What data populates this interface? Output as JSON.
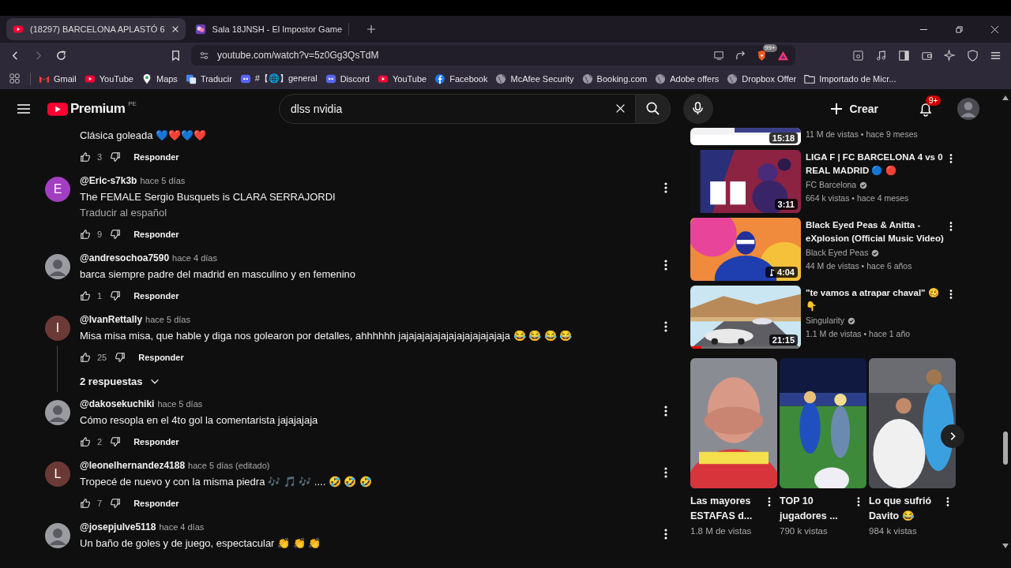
{
  "tabs": [
    {
      "title": "(18297) BARCELONA APLASTÓ 6",
      "selected": true
    },
    {
      "title": "Sala 18JNSH - El Impostor Game",
      "selected": false
    }
  ],
  "address_bar": {
    "url": "youtube.com/watch?v=5z0Gg3QsTdM",
    "shield_badge": "99+"
  },
  "bookmarks": [
    {
      "label": "Gmail",
      "kind": "gmail"
    },
    {
      "label": "YouTube",
      "kind": "youtube"
    },
    {
      "label": "Maps",
      "kind": "maps"
    },
    {
      "label": "Traducir",
      "kind": "translate"
    },
    {
      "label": "#【🌐】general",
      "kind": "discord"
    },
    {
      "label": "Discord",
      "kind": "discord"
    },
    {
      "label": "YouTube",
      "kind": "youtube"
    },
    {
      "label": "Facebook",
      "kind": "facebook"
    },
    {
      "label": "McAfee Security",
      "kind": "globe"
    },
    {
      "label": "Booking.com",
      "kind": "globe"
    },
    {
      "label": "Adobe offers",
      "kind": "globe"
    },
    {
      "label": "Dropbox Offer",
      "kind": "globe"
    },
    {
      "label": "Importado de Micr...",
      "kind": "folder"
    }
  ],
  "youtube_header": {
    "logo": "Premium",
    "region": "PE",
    "search": {
      "value": "dlss nvidia"
    },
    "create_label": "Crear",
    "notification_badge": "9+"
  },
  "comments": [
    {
      "text": "Clásica goleada 💙❤️💙❤️",
      "likes": "3",
      "reply_label": "Responder"
    },
    {
      "user": "@Eric-s7k3b",
      "time": "hace 5 días",
      "text": "The FEMALE Sergio Busquets is CLARA SERRAJORDI",
      "translate": "Traducir al español",
      "likes": "9",
      "reply_label": "Responder",
      "avatar": {
        "kind": "letter",
        "letter": "E",
        "color": "#a23ec2"
      }
    },
    {
      "user": "@andresochoa7590",
      "time": "hace 4 días",
      "text": "barca siempre padre del madrid en masculino y en femenino",
      "likes": "1",
      "reply_label": "Responder"
    },
    {
      "user": "@IvanRettally",
      "time": "hace 5 días",
      "text": "Misa misa misa, que hable y diga nos golearon por detalles, ahhhhhh jajajajajajajajajajajajajaja 😂 😂 😂 😂",
      "likes": "25",
      "reply_label": "Responder",
      "replies": "2 respuestas",
      "avatar": {
        "kind": "letter",
        "letter": "I",
        "color": "#6c3a36"
      }
    },
    {
      "user": "@dakosekuchiki",
      "time": "hace 5 días",
      "text": "Cómo resopla en el 4to gol la comentarista jajajajaja",
      "likes": "2",
      "reply_label": "Responder"
    },
    {
      "user": "@leonelhernandez4188",
      "time": "hace 5 días (editado)",
      "text": "Tropecé de nuevo y con la misma piedra 🎶 🎵 🎶 .... 🤣 🤣 🤣",
      "likes": "7",
      "reply_label": "Responder",
      "avatar": {
        "kind": "letter",
        "letter": "L",
        "color": "#6c3a36"
      }
    },
    {
      "user": "@josepjulve5118",
      "time": "hace 4 días",
      "text": "Un baño de goles y de juego, espectacular 👏 👏 👏"
    }
  ],
  "related_videos": [
    {
      "duration": "15:18",
      "meta": "11 M de vistas • hace 9 meses"
    },
    {
      "title": "LIGA F |  FC BARCELONA 4 vs 0 REAL MADRID 🔵 🔴",
      "channel": "FC Barcelona",
      "verified": true,
      "meta": "664 k vistas • hace 4 meses",
      "duration": "3:11"
    },
    {
      "title": "Black Eyed Peas & Anitta - eXplosion (Official Music Video)",
      "channel": "Black Eyed Peas",
      "verified": true,
      "meta": "44 M de vistas • hace 6 años",
      "duration": "4:04",
      "music": true
    },
    {
      "title": "\"te vamos a atrapar chaval\" 🥴 👇",
      "channel": "Singularity",
      "verified": true,
      "meta": "1.1 M de vistas • hace 1 año",
      "duration": "21:15",
      "level": 0.1
    }
  ],
  "shorts": [
    {
      "title": "Las mayores ESTAFAS d...",
      "views": "1.8 M de vistas"
    },
    {
      "title": "TOP 10 jugadores ...",
      "views": "790 k vistas"
    },
    {
      "title": "Lo que sufrió Davito 😂",
      "views": "984 k vistas"
    }
  ]
}
